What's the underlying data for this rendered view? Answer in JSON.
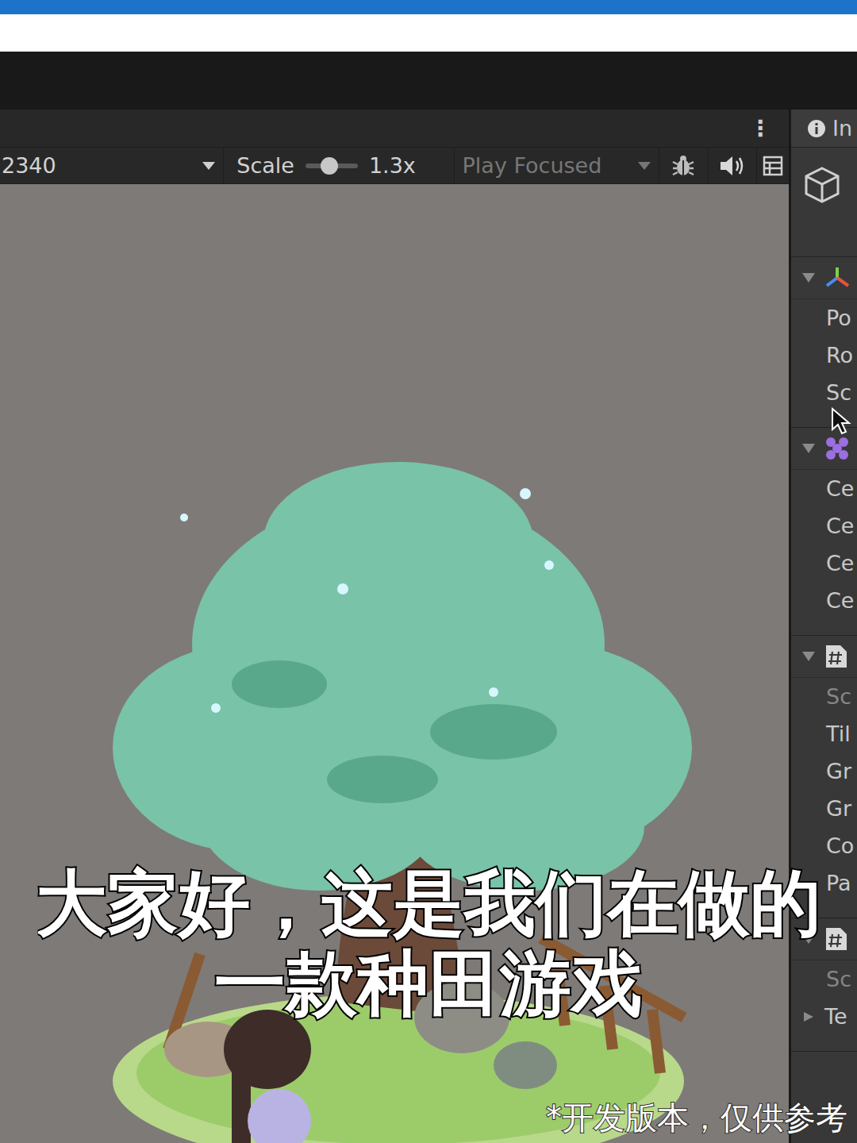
{
  "game_view": {
    "menu": "⋮",
    "resolution": "2340",
    "scale_label": "Scale",
    "scale": "1.3x",
    "scale_level": 0.45,
    "play_mode": "Play Focused"
  },
  "inspector": {
    "tab": "In",
    "sections": [
      {
        "expanded": true,
        "icon": "transform",
        "rows": [
          {
            "label": "Po",
            "disabled": false
          },
          {
            "label": "Ro",
            "disabled": false
          },
          {
            "label": "Sc",
            "disabled": false
          }
        ]
      },
      {
        "expanded": true,
        "icon": "grid",
        "rows": [
          {
            "label": "Ce",
            "disabled": false
          },
          {
            "label": "Ce",
            "disabled": false
          },
          {
            "label": "Ce",
            "disabled": false
          },
          {
            "label": "Ce",
            "disabled": false
          }
        ]
      },
      {
        "expanded": true,
        "icon": "script",
        "rows": [
          {
            "label": "Sc",
            "disabled": true
          },
          {
            "label": "Til",
            "disabled": false
          },
          {
            "label": "Gr",
            "disabled": false
          },
          {
            "label": "Gr",
            "disabled": false
          },
          {
            "label": "Co",
            "disabled": false
          },
          {
            "label": "Pa",
            "disabled": false
          }
        ]
      },
      {
        "expanded": true,
        "icon": "script",
        "rows": [
          {
            "label": "Sc",
            "disabled": true
          },
          {
            "label": "Te",
            "disabled": false,
            "foldout": true,
            "expanded": false
          }
        ]
      }
    ]
  },
  "subtitles": [
    "大家好，这是我们在做的",
    "一款种田游戏"
  ],
  "watermark": "*开发版本，仅供参考"
}
